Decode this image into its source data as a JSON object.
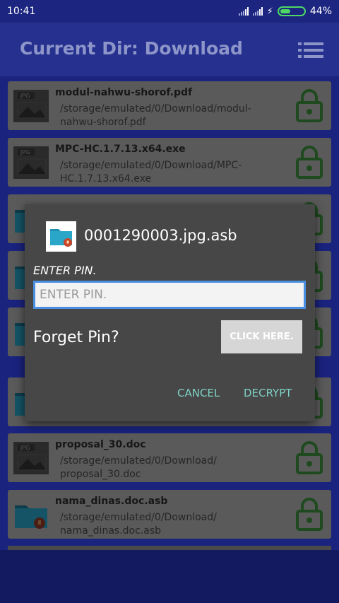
{
  "status_bar": {
    "time": "10:41",
    "battery_percent": "44%",
    "battery_level": 0.44
  },
  "header": {
    "title": "Current Dir: Download",
    "menu_icon": "list-menu-icon"
  },
  "files": [
    {
      "name": "modul-nahwu-shorof.pdf",
      "path": "/storage/emulated/0/Download/modul-nahwu-shorof.pdf",
      "thumb": "jpg",
      "badge": "JPG"
    },
    {
      "name": "MPC-HC.1.7.13.x64.exe",
      "path": "/storage/emulated/0/Download/MPC-HC.1.7.13.x64.exe",
      "thumb": "jpg",
      "badge": "JPG"
    },
    {
      "name": "",
      "path": "",
      "thumb": "folder",
      "badge": ""
    },
    {
      "name": "",
      "path": "",
      "thumb": "folder",
      "badge": ""
    },
    {
      "name": "",
      "path": "",
      "thumb": "folder",
      "badge": ""
    },
    {
      "name": "",
      "path": "",
      "thumb": "folder",
      "badge": ""
    },
    {
      "name": "proposal_30.doc",
      "path": "/storage/emulated/0/Download/ proposal_30.doc",
      "thumb": "jpg",
      "badge": "JPG"
    },
    {
      "name": "nama_dinas.doc.asb",
      "path": "/storage/emulated/0/Download/ nama_dinas.doc.asb",
      "thumb": "folder",
      "badge": ""
    }
  ],
  "dialog": {
    "title": "0001290003.jpg.asb",
    "pin_label": "ENTER PIN.",
    "pin_placeholder": "ENTER PIN.",
    "pin_value": "",
    "forget_text": "Forget Pin?",
    "click_here_label": "CLICK HERE.",
    "cancel_label": "CANCEL",
    "decrypt_label": "DECRYPT"
  },
  "colors": {
    "header_bg": "#25308f",
    "lock_green": "#1f4a1f",
    "accent_teal": "#7fd1c6",
    "input_border": "#4a90e2"
  }
}
